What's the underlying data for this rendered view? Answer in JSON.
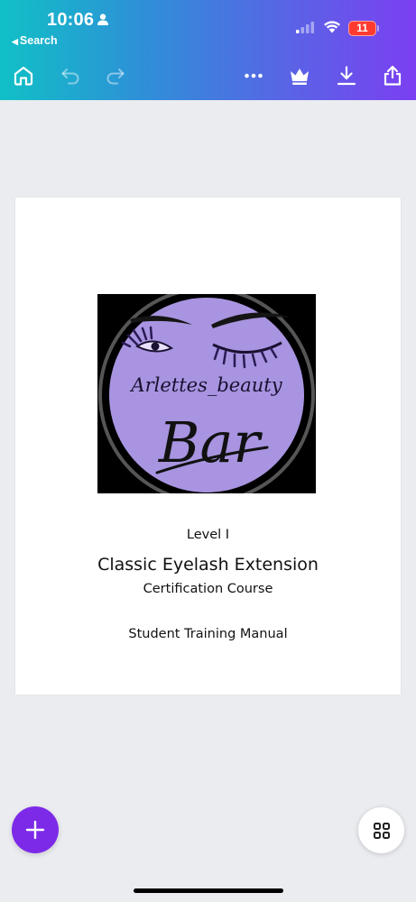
{
  "status_bar": {
    "time": "10:06",
    "back_label": "Search",
    "battery_percent": "11"
  },
  "toolbar": {
    "icons": [
      "home-icon",
      "undo-icon",
      "redo-icon",
      "more-icon",
      "crown-icon",
      "download-icon",
      "share-icon"
    ]
  },
  "document": {
    "logo": {
      "brand_text": "Arlettes_beauty",
      "brand_script": "Bar"
    },
    "level": "Level I",
    "title": "Classic Eyelash Extension",
    "subtitle": "Certification Course",
    "manual": "Student Training Manual"
  },
  "colors": {
    "gradient_start": "#10c0c6",
    "gradient_end": "#7b3ff2",
    "fab_purple": "#7d2ae8",
    "canvas_bg": "#ebecf0",
    "logo_lavender": "#a894e0"
  }
}
